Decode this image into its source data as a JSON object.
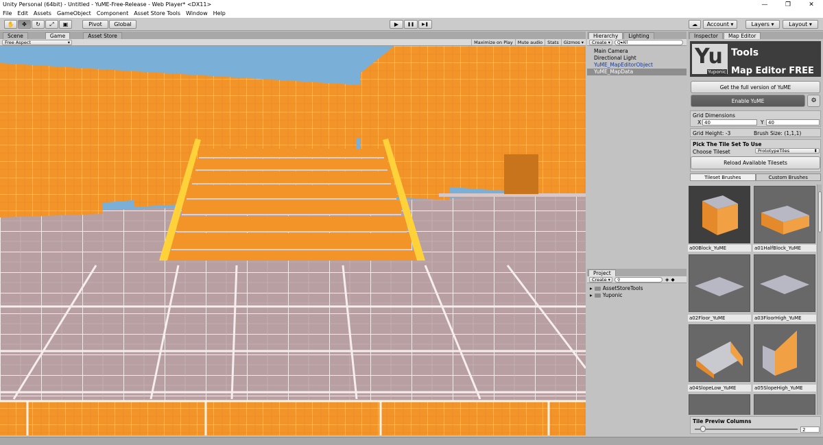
{
  "window": {
    "title": "Unity Personal (64bit) - Untitled - YuME-Free-Release - Web Player* <DX11>",
    "minimize": "—",
    "maximize": "❐",
    "close": "✕"
  },
  "menu": [
    "File",
    "Edit",
    "Assets",
    "GameObject",
    "Component",
    "Asset Store Tools",
    "Window",
    "Help"
  ],
  "toolbar": {
    "pivot": "Pivot",
    "global": "Global",
    "account": "Account",
    "layers": "Layers",
    "layout": "Layout",
    "play": "▶",
    "pause": "❚❚",
    "step": "▶❚",
    "cloud": "☁"
  },
  "sceneTabs": [
    "Scene",
    "Game",
    "Asset Store"
  ],
  "gameBar": {
    "aspect": "Free Aspect",
    "buttons": [
      "Maximize on Play",
      "Mute audio",
      "Stats",
      "Gizmos"
    ]
  },
  "hierarchy": {
    "tabs": [
      "Hierarchy",
      "Lighting"
    ],
    "create": "Create",
    "search": "Q▾All",
    "items": [
      {
        "label": "Main Camera",
        "style": ""
      },
      {
        "label": "Directional Light",
        "style": ""
      },
      {
        "label": "YuME_MapEditorObject",
        "style": "blue"
      },
      {
        "label": "YuME_MapData",
        "style": "sel"
      }
    ]
  },
  "project": {
    "tab": "Project",
    "create": "Create",
    "items": [
      "AssetStoreTools",
      "Yuponic"
    ]
  },
  "inspector": {
    "tabs": [
      "Inspector",
      "Map Editor"
    ],
    "logo": {
      "yu": "Yu",
      "tools": "Tools",
      "brand": "Yuponic",
      "title": "Map Editor FREE"
    },
    "getFull": "Get the full version of YuME",
    "enable": "Enable YuME",
    "gridDimensions": "Grid Dimensions",
    "xLabel": "X",
    "xValue": "40",
    "yLabel": "Y",
    "yValue": "40",
    "gridHeight": "Grid Height:  -3",
    "brushSize": "Brush Size: (1,1,1)",
    "pickTileSet": "Pick The Tile Set To Use",
    "chooseTileset": "Choose Tileset",
    "tilesetValue": "PrototypeTiles",
    "reload": "Reload Available Tilesets",
    "brushTabs": [
      "Tileset Brushes",
      "Custom Brushes"
    ],
    "tiles": [
      "a00Block_YuME",
      "a01HalfBlock_YuME",
      "a02Floor_YuME",
      "a03FloorHigh_YuME",
      "a04SlopeLow_YuME",
      "a05SlopeHigh_YuME"
    ],
    "previewColumns": "Tile Previw Columns",
    "previewValue": "2"
  },
  "viewport": {
    "sky": "#7ab0d8",
    "orange": "#f08a1f",
    "floor": "#b59a9c"
  }
}
